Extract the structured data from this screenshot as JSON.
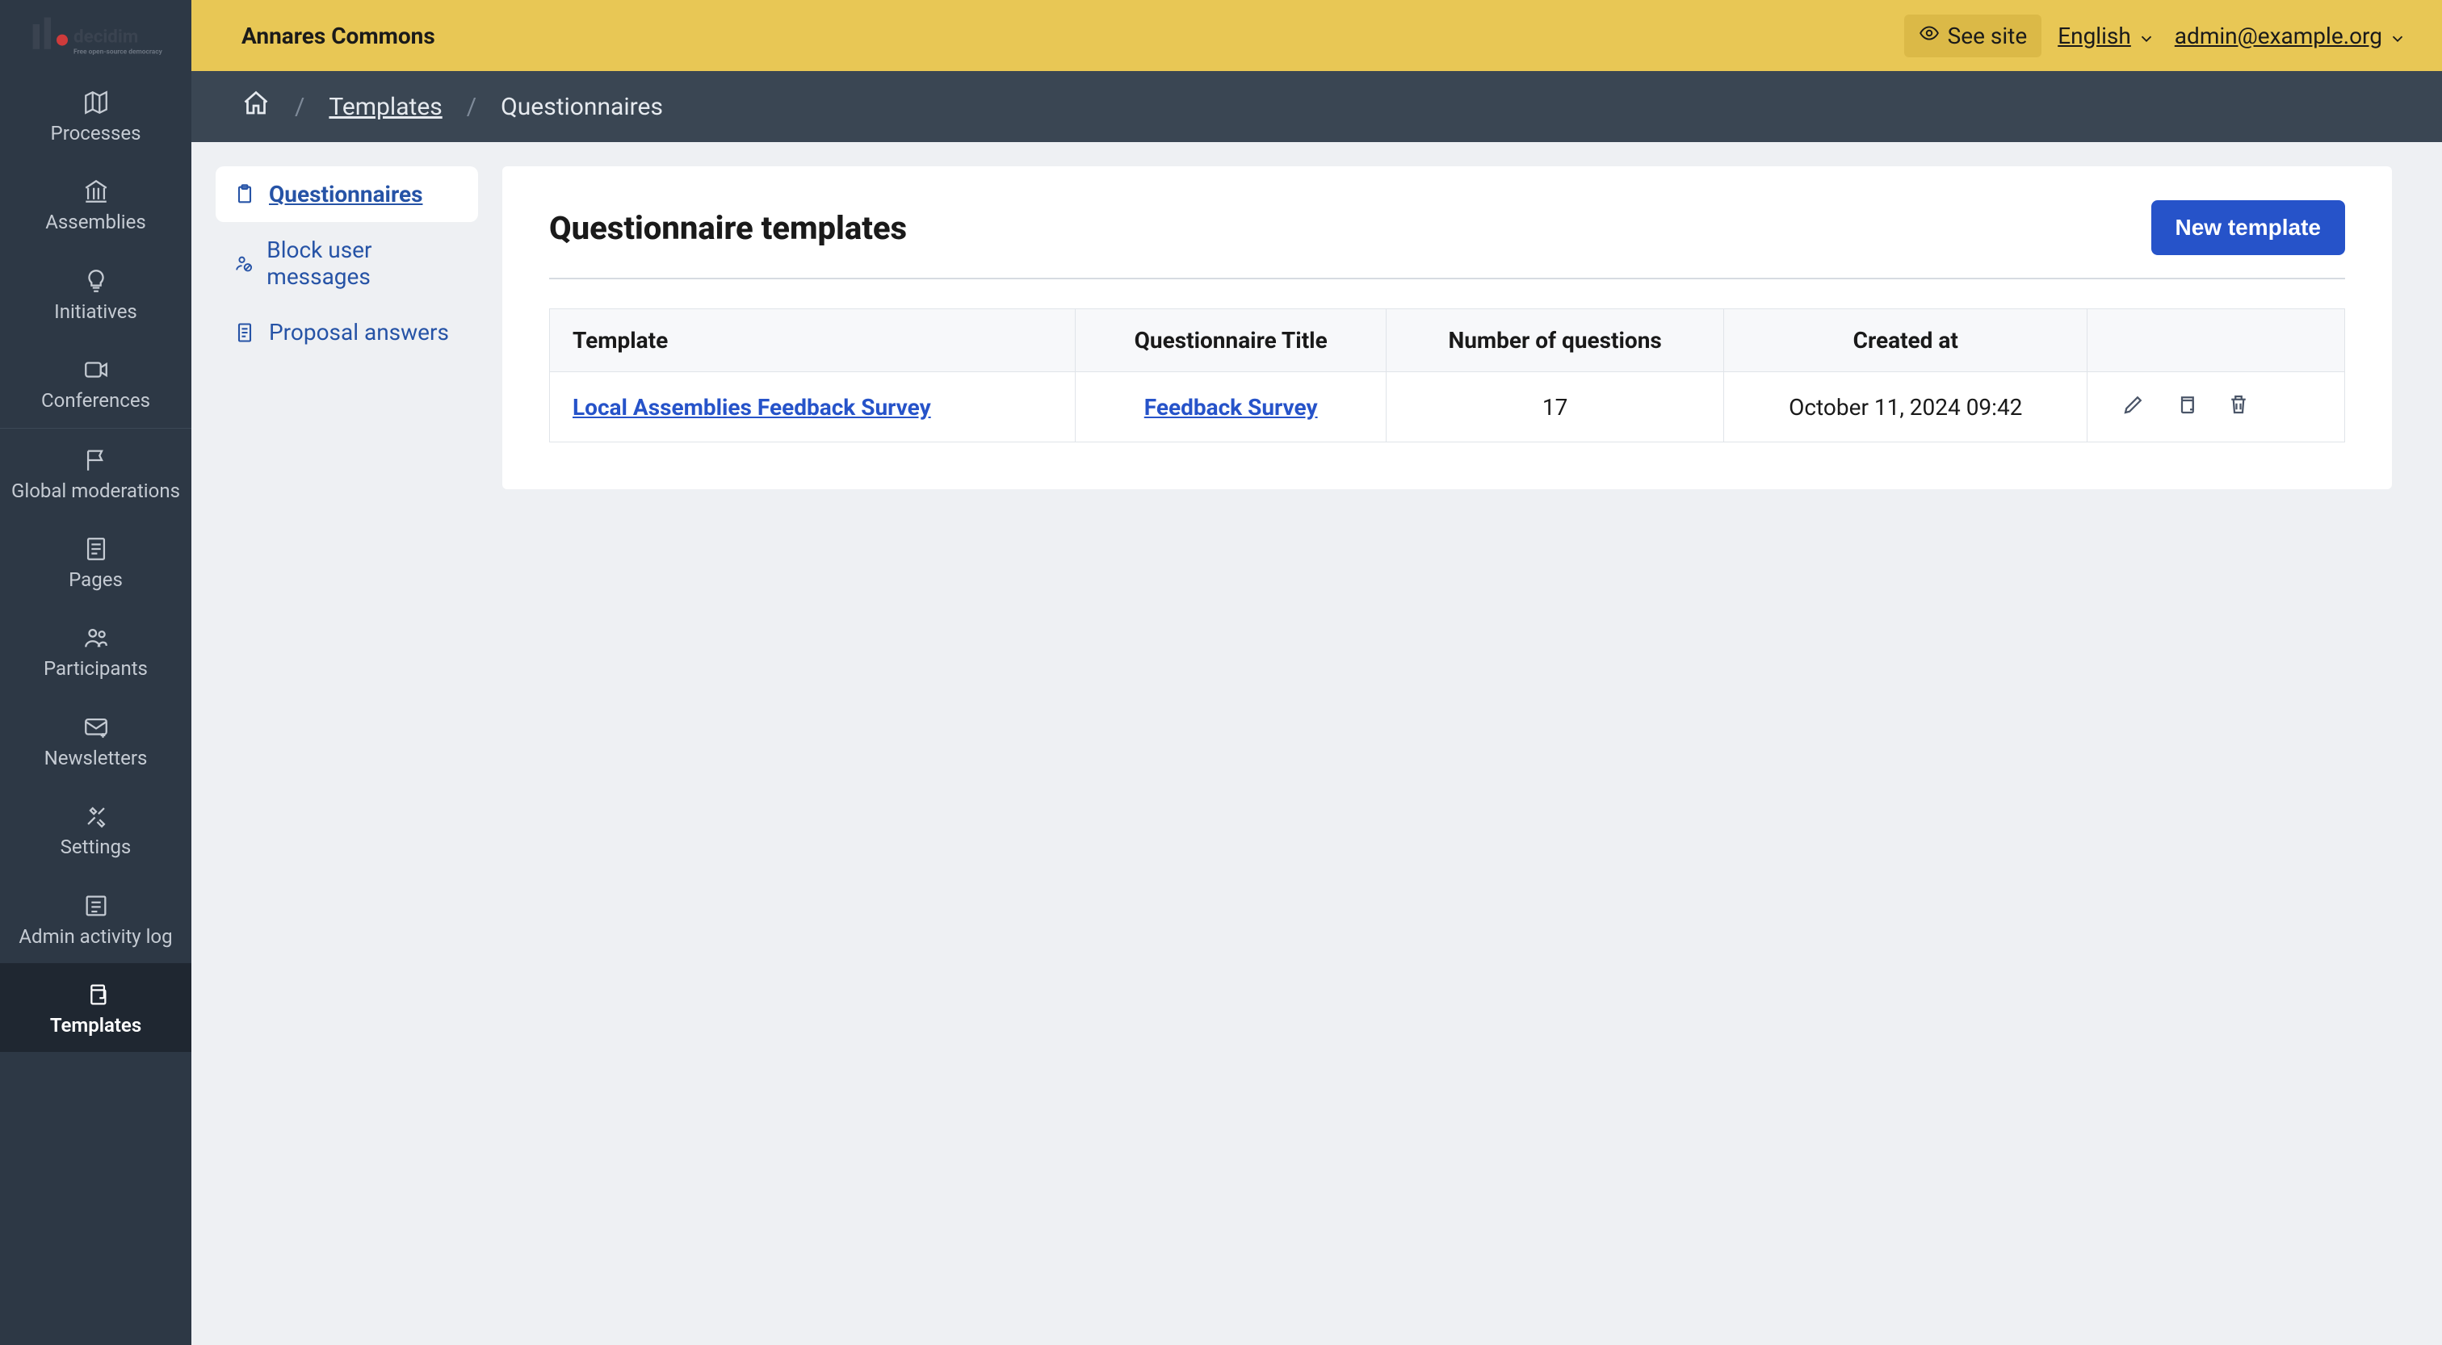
{
  "org": {
    "name": "Annares Commons"
  },
  "topbar": {
    "see_site": "See site",
    "language": "English",
    "user_email": "admin@example.org"
  },
  "breadcrumb": {
    "home": "Home",
    "templates": "Templates",
    "current": "Questionnaires"
  },
  "main_nav": [
    {
      "id": "processes",
      "label": "Processes"
    },
    {
      "id": "assemblies",
      "label": "Assemblies"
    },
    {
      "id": "initiatives",
      "label": "Initiatives"
    },
    {
      "id": "conferences",
      "label": "Conferences"
    },
    {
      "id": "global-moderations",
      "label": "Global moderations"
    },
    {
      "id": "pages",
      "label": "Pages"
    },
    {
      "id": "participants",
      "label": "Participants"
    },
    {
      "id": "newsletters",
      "label": "Newsletters"
    },
    {
      "id": "settings",
      "label": "Settings"
    },
    {
      "id": "admin-activity-log",
      "label": "Admin activity log"
    },
    {
      "id": "templates",
      "label": "Templates"
    }
  ],
  "sub_nav": {
    "questionnaires": "Questionnaires",
    "block_user_messages": "Block user messages",
    "proposal_answers": "Proposal answers"
  },
  "panel": {
    "title": "Questionnaire templates",
    "new_button": "New template"
  },
  "table": {
    "headers": {
      "template": "Template",
      "title": "Questionnaire Title",
      "count": "Number of questions",
      "created": "Created at"
    },
    "rows": [
      {
        "template": "Local Assemblies Feedback Survey",
        "title": "Feedback Survey",
        "count": "17",
        "created": "October 11, 2024 09:42"
      }
    ]
  },
  "colors": {
    "topbar": "#e8c755",
    "sidebar": "#2d3845",
    "crumbbar": "#3a4653",
    "primary": "#2653c9"
  }
}
